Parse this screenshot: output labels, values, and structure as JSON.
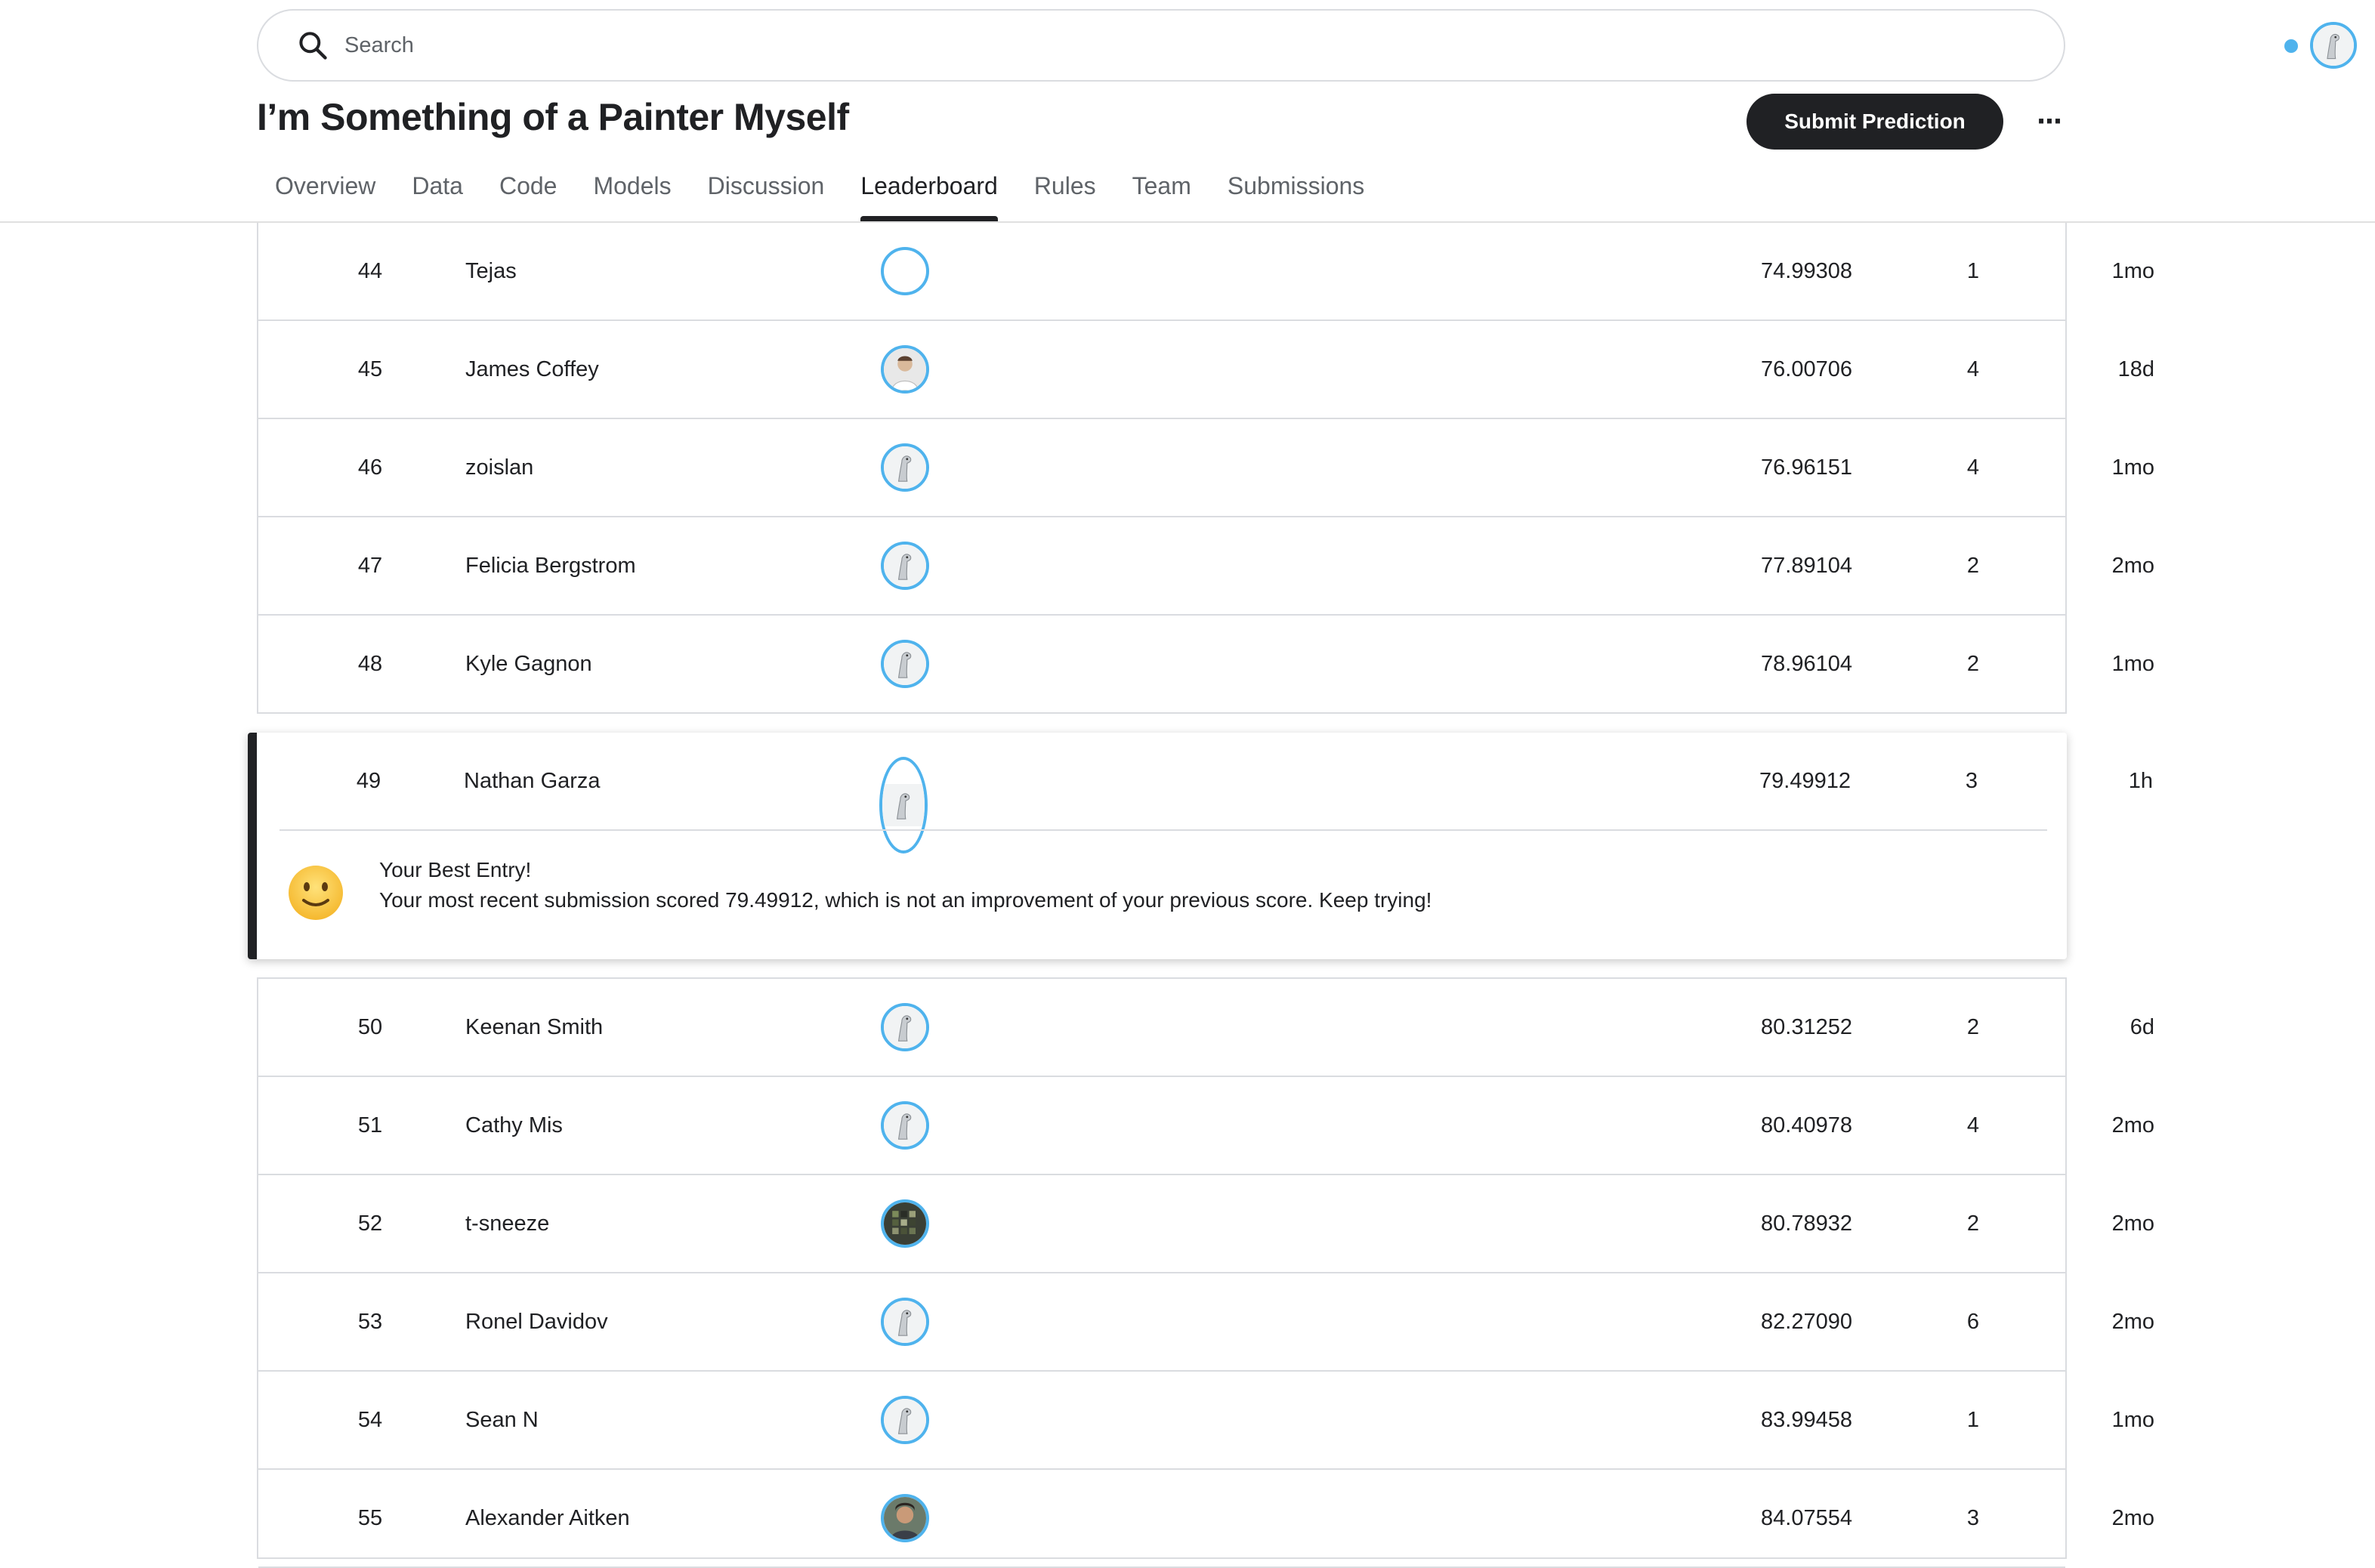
{
  "search": {
    "placeholder": "Search",
    "icon": "search-icon"
  },
  "header": {
    "title": "I’m Something of a Painter Myself",
    "submit_label": "Submit Prediction",
    "more_label": "···"
  },
  "tabs": [
    {
      "label": "Overview"
    },
    {
      "label": "Data"
    },
    {
      "label": "Code"
    },
    {
      "label": "Models"
    },
    {
      "label": "Discussion"
    },
    {
      "label": "Leaderboard",
      "active": true
    },
    {
      "label": "Rules"
    },
    {
      "label": "Team"
    },
    {
      "label": "Submissions"
    }
  ],
  "leaderboard": {
    "rows_before": [
      {
        "rank": "44",
        "name": "Tejas",
        "avatar": "empty",
        "score": "74.99308",
        "entries": "1",
        "last": "1mo"
      },
      {
        "rank": "45",
        "name": "James Coffey",
        "avatar": "photo-person",
        "score": "76.00706",
        "entries": "4",
        "last": "18d"
      },
      {
        "rank": "46",
        "name": "zoislan",
        "avatar": "default-goose",
        "score": "76.96151",
        "entries": "4",
        "last": "1mo"
      },
      {
        "rank": "47",
        "name": "Felicia Bergstrom",
        "avatar": "default-goose",
        "score": "77.89104",
        "entries": "2",
        "last": "2mo"
      },
      {
        "rank": "48",
        "name": "Kyle Gagnon",
        "avatar": "default-goose",
        "score": "78.96104",
        "entries": "2",
        "last": "1mo"
      }
    ],
    "current_user": {
      "rank": "49",
      "name": "Nathan Garza",
      "avatar": "default-goose",
      "score": "79.49912",
      "entries": "3",
      "last": "1h",
      "message_title": "Your Best Entry!",
      "message_body": "Your most recent submission scored 79.49912, which is not an improvement of your previous score. Keep trying!",
      "message_icon": "slightly-smiling-face-icon"
    },
    "rows_after": [
      {
        "rank": "50",
        "name": "Keenan Smith",
        "avatar": "default-goose",
        "score": "80.31252",
        "entries": "2",
        "last": "6d"
      },
      {
        "rank": "51",
        "name": "Cathy Mis",
        "avatar": "default-goose",
        "score": "80.40978",
        "entries": "4",
        "last": "2mo"
      },
      {
        "rank": "52",
        "name": "t-sneeze",
        "avatar": "pixel-pattern",
        "score": "80.78932",
        "entries": "2",
        "last": "2mo"
      },
      {
        "rank": "53",
        "name": "Ronel Davidov",
        "avatar": "default-goose",
        "score": "82.27090",
        "entries": "6",
        "last": "2mo"
      },
      {
        "rank": "54",
        "name": "Sean N",
        "avatar": "default-goose",
        "score": "83.99458",
        "entries": "1",
        "last": "1mo"
      },
      {
        "rank": "55",
        "name": "Alexander Aitken",
        "avatar": "photo-person-dark",
        "score": "84.07554",
        "entries": "3",
        "last": "2mo"
      }
    ]
  },
  "colors": {
    "accent_ring": "#4fb3ed",
    "primary_button": "#202124",
    "border": "#dadce0"
  }
}
